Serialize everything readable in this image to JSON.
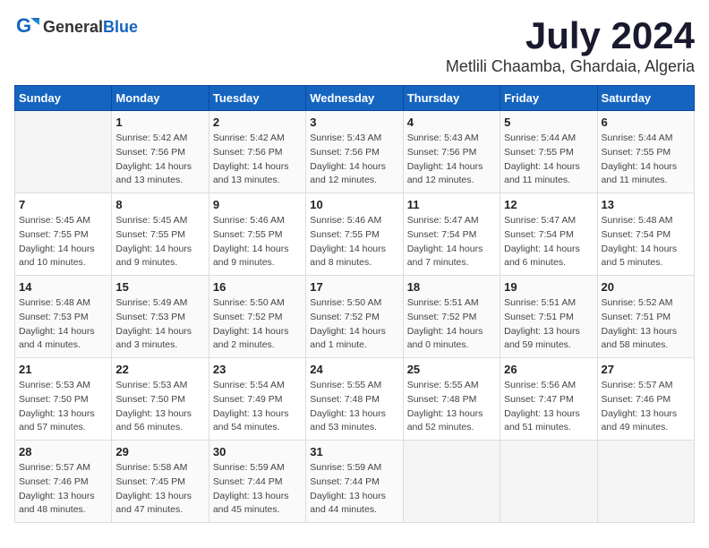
{
  "header": {
    "logo_general": "General",
    "logo_blue": "Blue",
    "month": "July 2024",
    "location": "Metlili Chaamba, Ghardaia, Algeria"
  },
  "weekdays": [
    "Sunday",
    "Monday",
    "Tuesday",
    "Wednesday",
    "Thursday",
    "Friday",
    "Saturday"
  ],
  "weeks": [
    [
      {
        "day": "",
        "sunrise": "",
        "sunset": "",
        "daylight": ""
      },
      {
        "day": "1",
        "sunrise": "Sunrise: 5:42 AM",
        "sunset": "Sunset: 7:56 PM",
        "daylight": "Daylight: 14 hours and 13 minutes."
      },
      {
        "day": "2",
        "sunrise": "Sunrise: 5:42 AM",
        "sunset": "Sunset: 7:56 PM",
        "daylight": "Daylight: 14 hours and 13 minutes."
      },
      {
        "day": "3",
        "sunrise": "Sunrise: 5:43 AM",
        "sunset": "Sunset: 7:56 PM",
        "daylight": "Daylight: 14 hours and 12 minutes."
      },
      {
        "day": "4",
        "sunrise": "Sunrise: 5:43 AM",
        "sunset": "Sunset: 7:56 PM",
        "daylight": "Daylight: 14 hours and 12 minutes."
      },
      {
        "day": "5",
        "sunrise": "Sunrise: 5:44 AM",
        "sunset": "Sunset: 7:55 PM",
        "daylight": "Daylight: 14 hours and 11 minutes."
      },
      {
        "day": "6",
        "sunrise": "Sunrise: 5:44 AM",
        "sunset": "Sunset: 7:55 PM",
        "daylight": "Daylight: 14 hours and 11 minutes."
      }
    ],
    [
      {
        "day": "7",
        "sunrise": "Sunrise: 5:45 AM",
        "sunset": "Sunset: 7:55 PM",
        "daylight": "Daylight: 14 hours and 10 minutes."
      },
      {
        "day": "8",
        "sunrise": "Sunrise: 5:45 AM",
        "sunset": "Sunset: 7:55 PM",
        "daylight": "Daylight: 14 hours and 9 minutes."
      },
      {
        "day": "9",
        "sunrise": "Sunrise: 5:46 AM",
        "sunset": "Sunset: 7:55 PM",
        "daylight": "Daylight: 14 hours and 9 minutes."
      },
      {
        "day": "10",
        "sunrise": "Sunrise: 5:46 AM",
        "sunset": "Sunset: 7:55 PM",
        "daylight": "Daylight: 14 hours and 8 minutes."
      },
      {
        "day": "11",
        "sunrise": "Sunrise: 5:47 AM",
        "sunset": "Sunset: 7:54 PM",
        "daylight": "Daylight: 14 hours and 7 minutes."
      },
      {
        "day": "12",
        "sunrise": "Sunrise: 5:47 AM",
        "sunset": "Sunset: 7:54 PM",
        "daylight": "Daylight: 14 hours and 6 minutes."
      },
      {
        "day": "13",
        "sunrise": "Sunrise: 5:48 AM",
        "sunset": "Sunset: 7:54 PM",
        "daylight": "Daylight: 14 hours and 5 minutes."
      }
    ],
    [
      {
        "day": "14",
        "sunrise": "Sunrise: 5:48 AM",
        "sunset": "Sunset: 7:53 PM",
        "daylight": "Daylight: 14 hours and 4 minutes."
      },
      {
        "day": "15",
        "sunrise": "Sunrise: 5:49 AM",
        "sunset": "Sunset: 7:53 PM",
        "daylight": "Daylight: 14 hours and 3 minutes."
      },
      {
        "day": "16",
        "sunrise": "Sunrise: 5:50 AM",
        "sunset": "Sunset: 7:52 PM",
        "daylight": "Daylight: 14 hours and 2 minutes."
      },
      {
        "day": "17",
        "sunrise": "Sunrise: 5:50 AM",
        "sunset": "Sunset: 7:52 PM",
        "daylight": "Daylight: 14 hours and 1 minute."
      },
      {
        "day": "18",
        "sunrise": "Sunrise: 5:51 AM",
        "sunset": "Sunset: 7:52 PM",
        "daylight": "Daylight: 14 hours and 0 minutes."
      },
      {
        "day": "19",
        "sunrise": "Sunrise: 5:51 AM",
        "sunset": "Sunset: 7:51 PM",
        "daylight": "Daylight: 13 hours and 59 minutes."
      },
      {
        "day": "20",
        "sunrise": "Sunrise: 5:52 AM",
        "sunset": "Sunset: 7:51 PM",
        "daylight": "Daylight: 13 hours and 58 minutes."
      }
    ],
    [
      {
        "day": "21",
        "sunrise": "Sunrise: 5:53 AM",
        "sunset": "Sunset: 7:50 PM",
        "daylight": "Daylight: 13 hours and 57 minutes."
      },
      {
        "day": "22",
        "sunrise": "Sunrise: 5:53 AM",
        "sunset": "Sunset: 7:50 PM",
        "daylight": "Daylight: 13 hours and 56 minutes."
      },
      {
        "day": "23",
        "sunrise": "Sunrise: 5:54 AM",
        "sunset": "Sunset: 7:49 PM",
        "daylight": "Daylight: 13 hours and 54 minutes."
      },
      {
        "day": "24",
        "sunrise": "Sunrise: 5:55 AM",
        "sunset": "Sunset: 7:48 PM",
        "daylight": "Daylight: 13 hours and 53 minutes."
      },
      {
        "day": "25",
        "sunrise": "Sunrise: 5:55 AM",
        "sunset": "Sunset: 7:48 PM",
        "daylight": "Daylight: 13 hours and 52 minutes."
      },
      {
        "day": "26",
        "sunrise": "Sunrise: 5:56 AM",
        "sunset": "Sunset: 7:47 PM",
        "daylight": "Daylight: 13 hours and 51 minutes."
      },
      {
        "day": "27",
        "sunrise": "Sunrise: 5:57 AM",
        "sunset": "Sunset: 7:46 PM",
        "daylight": "Daylight: 13 hours and 49 minutes."
      }
    ],
    [
      {
        "day": "28",
        "sunrise": "Sunrise: 5:57 AM",
        "sunset": "Sunset: 7:46 PM",
        "daylight": "Daylight: 13 hours and 48 minutes."
      },
      {
        "day": "29",
        "sunrise": "Sunrise: 5:58 AM",
        "sunset": "Sunset: 7:45 PM",
        "daylight": "Daylight: 13 hours and 47 minutes."
      },
      {
        "day": "30",
        "sunrise": "Sunrise: 5:59 AM",
        "sunset": "Sunset: 7:44 PM",
        "daylight": "Daylight: 13 hours and 45 minutes."
      },
      {
        "day": "31",
        "sunrise": "Sunrise: 5:59 AM",
        "sunset": "Sunset: 7:44 PM",
        "daylight": "Daylight: 13 hours and 44 minutes."
      },
      {
        "day": "",
        "sunrise": "",
        "sunset": "",
        "daylight": ""
      },
      {
        "day": "",
        "sunrise": "",
        "sunset": "",
        "daylight": ""
      },
      {
        "day": "",
        "sunrise": "",
        "sunset": "",
        "daylight": ""
      }
    ]
  ]
}
